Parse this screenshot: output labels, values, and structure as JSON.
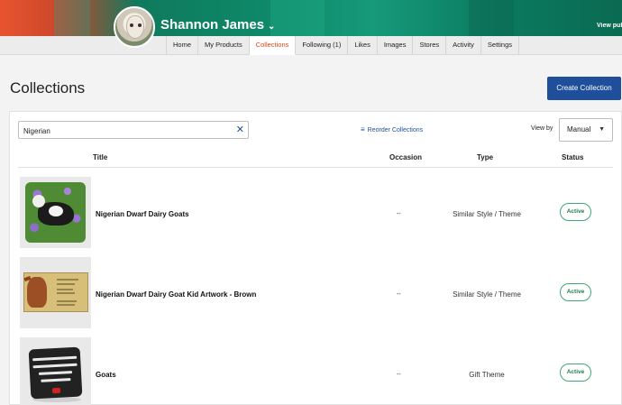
{
  "profile": {
    "name": "Shannon James",
    "view_public": "View pub"
  },
  "nav": {
    "tabs": [
      {
        "label": "Home",
        "active": false
      },
      {
        "label": "My Products",
        "active": false
      },
      {
        "label": "Collections",
        "active": true
      },
      {
        "label": "Following (1)",
        "active": false
      },
      {
        "label": "Likes",
        "active": false
      },
      {
        "label": "Images",
        "active": false
      },
      {
        "label": "Stores",
        "active": false
      },
      {
        "label": "Activity",
        "active": false
      },
      {
        "label": "Settings",
        "active": false
      }
    ]
  },
  "page": {
    "title": "Collections",
    "create_label": "Create Collection"
  },
  "toolbar": {
    "search_value": "Nigerian",
    "reorder_label": "Reorder Collections",
    "view_by_label": "View by",
    "view_by_value": "Manual"
  },
  "table": {
    "headers": {
      "title": "Title",
      "occasion": "Occasion",
      "type": "Type",
      "status": "Status"
    },
    "rows": [
      {
        "title": "Nigerian Dwarf Dairy Goats",
        "occasion": "--",
        "type": "Similar Style / Theme",
        "status": "Active"
      },
      {
        "title": "Nigerian Dwarf Dairy Goat Kid Artwork - Brown",
        "occasion": "--",
        "type": "Similar Style / Theme",
        "status": "Active"
      },
      {
        "title": "Goats",
        "occasion": "--",
        "type": "Gift Theme",
        "status": "Active"
      }
    ]
  },
  "colors": {
    "accent": "#1f4f9b",
    "active_tab": "#d24a1a",
    "status_green": "#3fa876"
  }
}
